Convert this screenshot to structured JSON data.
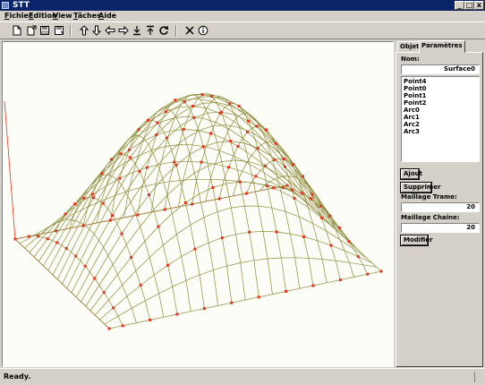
{
  "window": {
    "title": "STT",
    "minimize_glyph": "_",
    "maximize_glyph": "□",
    "close_glyph": "x"
  },
  "menu": [
    {
      "accel": "F",
      "rest": "ichier"
    },
    {
      "accel": "E",
      "rest": "dition"
    },
    {
      "accel": "V",
      "rest": "iew"
    },
    {
      "accel": "T",
      "rest": "âches"
    },
    {
      "accel": "A",
      "rest": "ide"
    }
  ],
  "toolbar": {
    "icons": [
      "new-file-icon",
      "open-file-icon",
      "save-icon",
      "save-as-icon",
      "move-up-icon",
      "move-down-icon",
      "move-left-icon",
      "move-right-icon",
      "anchor-down-icon",
      "anchor-up-icon",
      "refresh-icon",
      "delete-icon",
      "info-icon"
    ]
  },
  "panel": {
    "tabs": [
      "Objets",
      "Paramètres"
    ],
    "active_tab": "Paramètres",
    "nom_label": "Nom:",
    "nom_value": "Surface0",
    "objects": [
      "Point4",
      "Point0",
      "Point1",
      "Point2",
      "Arc0",
      "Arc1",
      "Arc2",
      "Arc3"
    ],
    "add_button": "Ajout",
    "delete_button": "Supprimer",
    "trame_label": "Maillage Trame:",
    "trame_value": "20",
    "chaine_label": "Maillage Chaine:",
    "chaine_value": "20",
    "modify_button": "Modifier"
  },
  "status": "Ready.",
  "colors": {
    "mesh": "#8c8c3c",
    "points": "#e8321e",
    "frame": "#e8321e",
    "titlebar": "#0a246a"
  }
}
